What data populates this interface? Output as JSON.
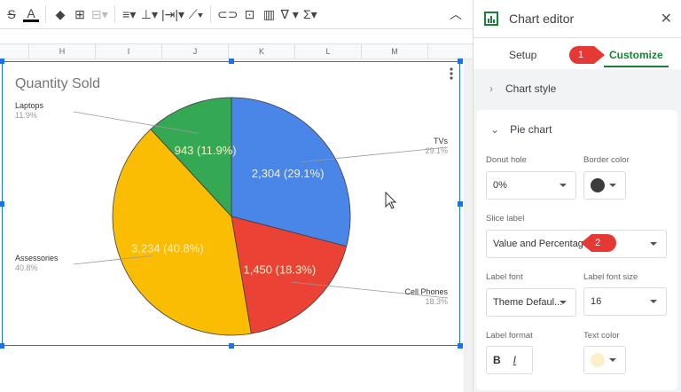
{
  "toolbar": {
    "icons": [
      "strikethrough-icon",
      "text-color-icon",
      "fill-color-icon",
      "borders-icon",
      "merge-icon",
      "align-icon",
      "valign-icon",
      "wrap-icon",
      "rotate-icon",
      "link-icon",
      "comment-icon",
      "chart-icon",
      "filter-icon",
      "functions-icon",
      "collapse-icon"
    ]
  },
  "columns": [
    "",
    "H",
    "I",
    "J",
    "K",
    "L",
    "M"
  ],
  "chart_data": {
    "type": "pie",
    "title": "Quantity Sold",
    "slices": [
      {
        "name": "TVs",
        "value": 2304,
        "percent": 29.1,
        "label": "2,304 (29.1%)",
        "legend_pct": "29.1%",
        "color": "#4a86e8"
      },
      {
        "name": "Cell Phones",
        "value": 1450,
        "percent": 18.3,
        "label": "1,450 (18.3%)",
        "legend_pct": "18.3%",
        "color": "#ea4335"
      },
      {
        "name": "Assessories",
        "value": 3234,
        "percent": 40.8,
        "label": "3,234 (40.8%)",
        "legend_pct": "40.8%",
        "color": "#fbbc04"
      },
      {
        "name": "Laptops",
        "value": 943,
        "percent": 11.9,
        "label": "943 (11.9%)",
        "legend_pct": "11.9%",
        "color": "#34a853"
      }
    ]
  },
  "editor": {
    "title": "Chart editor",
    "tabs": {
      "setup": "Setup",
      "customize": "Customize"
    },
    "chart_style": "Chart style",
    "pie_chart": "Pie chart",
    "donut_hole": {
      "label": "Donut hole",
      "value": "0%"
    },
    "border_color": {
      "label": "Border color",
      "value": "#3c3c3c"
    },
    "slice_label": {
      "label": "Slice label",
      "value": "Value and Percentage"
    },
    "label_font": {
      "label": "Label font",
      "value": "Theme Defaul..."
    },
    "label_font_size": {
      "label": "Label font size",
      "value": "16"
    },
    "label_format": {
      "label": "Label format",
      "bold": "B",
      "italic": "I"
    },
    "text_color": {
      "label": "Text color",
      "value": "#fdefc8"
    }
  },
  "annotations": {
    "one": "1",
    "two": "2"
  }
}
